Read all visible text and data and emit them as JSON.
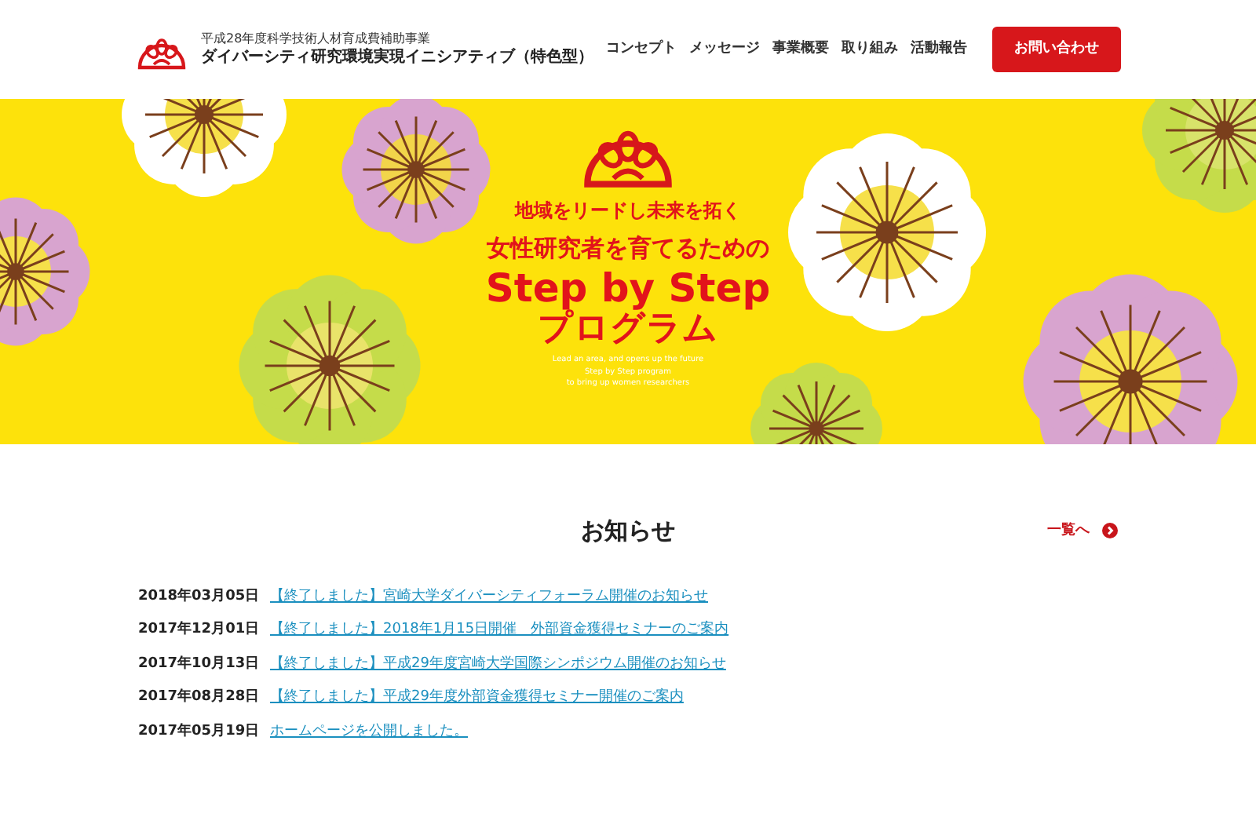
{
  "header": {
    "subtitle": "平成28年度科学技術人材育成費補助事業",
    "title": "ダイバーシティ研究環境実現イニシアティブ（特色型）",
    "nav": [
      {
        "label": "コンセプト"
      },
      {
        "label": "メッセージ"
      },
      {
        "label": "事業概要"
      },
      {
        "label": "取り組み"
      },
      {
        "label": "活動報告"
      }
    ],
    "contact_button": "お問い合わせ"
  },
  "hero": {
    "tagline": "地域をリードし未来を拓く",
    "heading": "女性研究者を育てるための",
    "title": "Step by Step",
    "title2": "プログラム",
    "english": [
      "Lead an area, and opens up the future",
      "Step by Step program",
      "to bring up women researchers"
    ]
  },
  "news": {
    "heading": "お知らせ",
    "more_link": "一覧へ",
    "items": [
      {
        "date": "2018年03月05日",
        "title": "【終了しました】宮崎大学ダイバーシティフォーラム開催のお知らせ"
      },
      {
        "date": "2017年12月01日",
        "title": "【終了しました】2018年1月15日開催　外部資金獲得セミナーのご案内"
      },
      {
        "date": "2017年10月13日",
        "title": "【終了しました】平成29年度宮崎大学国際シンポジウム開催のお知らせ"
      },
      {
        "date": "2017年08月28日",
        "title": "【終了しました】平成29年度外部資金獲得セミナー開催のご案内"
      },
      {
        "date": "2017年05月19日",
        "title": "ホームページを公開しました。"
      }
    ]
  }
}
